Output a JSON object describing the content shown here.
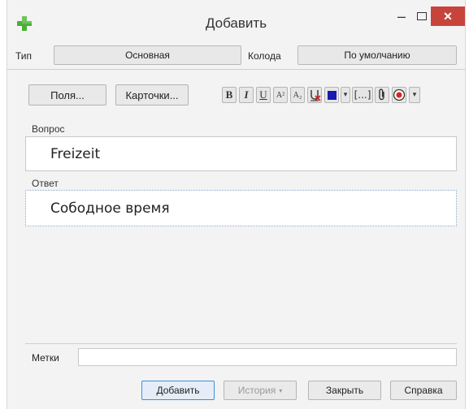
{
  "window": {
    "title": "Добавить",
    "minimize_glyph": "–",
    "close_glyph": "✕",
    "icon": "plus-icon",
    "accent_color": "#c7443c",
    "icon_color": "#4caf3a"
  },
  "note_info": {
    "type_label": "Тип",
    "type_value": "Основная",
    "deck_label": "Колода",
    "deck_value": "По умолчанию"
  },
  "toolbar": {
    "fields_button": "Поля...",
    "cards_button": "Карточки...",
    "bold": "B",
    "italic": "I",
    "underline": "U",
    "superscript": "A²",
    "subscript": "A₂",
    "cloze": "[...]",
    "dropdown_glyph": "▾",
    "text_color": "#1a1ab0"
  },
  "fields": [
    {
      "label": "Вопрос",
      "value": "Freizeit"
    },
    {
      "label": "Ответ",
      "value": "Собoдное время"
    }
  ],
  "tags": {
    "label": "Метки",
    "value": ""
  },
  "buttons": {
    "add": "Добавить",
    "history": "История",
    "history_arrow": "▾",
    "close": "Закрыть",
    "help": "Справка"
  }
}
